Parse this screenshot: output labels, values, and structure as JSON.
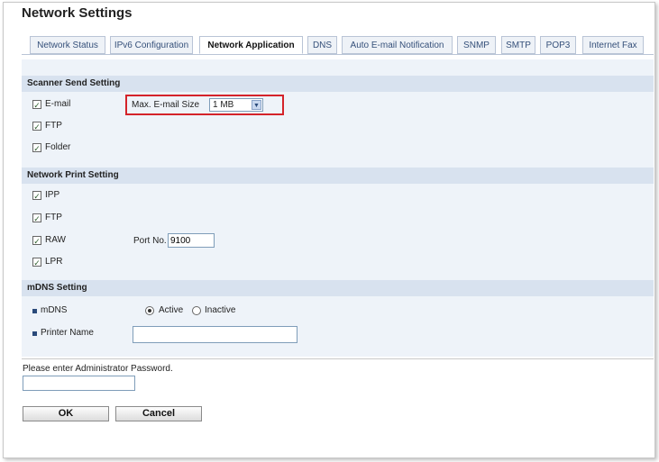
{
  "page": {
    "title": "Network Settings"
  },
  "tabs": [
    {
      "label": "Network Status"
    },
    {
      "label": "IPv6 Configuration"
    },
    {
      "label": "Network Application",
      "active": true
    },
    {
      "label": "DNS"
    },
    {
      "label": "Auto E-mail Notification"
    },
    {
      "label": "SNMP"
    },
    {
      "label": "SMTP"
    },
    {
      "label": "POP3"
    },
    {
      "label": "Internet Fax"
    }
  ],
  "scanner_send": {
    "heading": "Scanner Send Setting",
    "email_label": "E-mail",
    "email_checked": true,
    "ftp_label": "FTP",
    "ftp_checked": true,
    "folder_label": "Folder",
    "folder_checked": true,
    "max_size_label": "Max. E-mail Size",
    "max_size_value": "1 MB"
  },
  "network_print": {
    "heading": "Network Print Setting",
    "ipp_label": "IPP",
    "ftp_label": "FTP",
    "raw_label": "RAW",
    "lpr_label": "LPR",
    "port_label": "Port No.",
    "port_value": "9100"
  },
  "mdns": {
    "heading": "mDNS Setting",
    "mdns_label": "mDNS",
    "active_label": "Active",
    "inactive_label": "Inactive",
    "selected": "Active",
    "printer_name_label": "Printer Name",
    "printer_name_value": ""
  },
  "admin": {
    "password_prompt": "Please enter Administrator Password.",
    "password_value": ""
  },
  "buttons": {
    "ok": "OK",
    "cancel": "Cancel"
  },
  "colors": {
    "accent": "#d4232a",
    "section_bg": "#d8e2ef",
    "panel_bg": "#eef3f9"
  }
}
